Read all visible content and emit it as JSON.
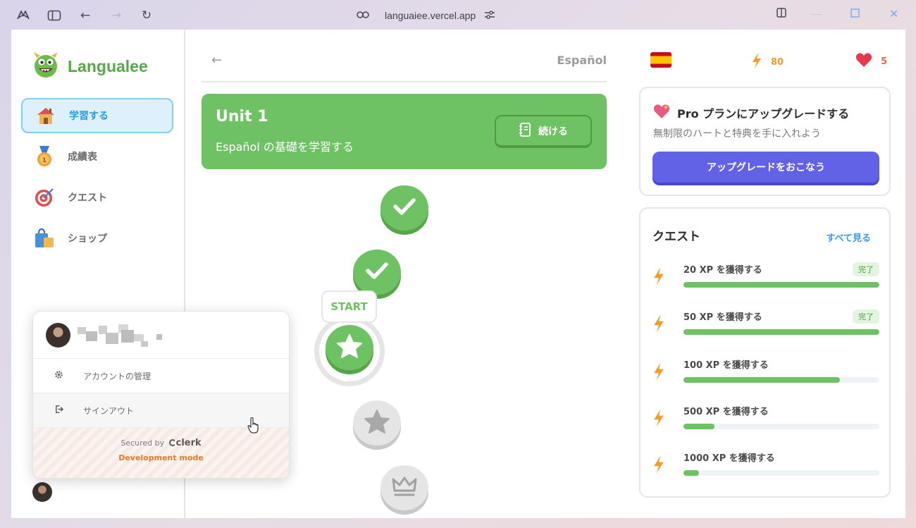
{
  "browser": {
    "url": "languaiee.vercel.app"
  },
  "sidebar": {
    "logo_text": "Langualee",
    "items": [
      {
        "label": "学習する",
        "icon": "house-icon",
        "active": true
      },
      {
        "label": "成績表",
        "icon": "medal-icon",
        "active": false
      },
      {
        "label": "クエスト",
        "icon": "target-icon",
        "active": false
      },
      {
        "label": "ショップ",
        "icon": "shopping-bag-icon",
        "active": false
      }
    ]
  },
  "user_popup": {
    "manage_account": "アカウントの管理",
    "sign_out": "サインアウト",
    "secured_by": "Secured by",
    "clerk_brand": "clerk",
    "dev_mode": "Development mode"
  },
  "header": {
    "language": "Español"
  },
  "unit": {
    "title": "Unit 1",
    "description": "Español の基礎を学習する",
    "continue_label": "続ける"
  },
  "lessons": {
    "start_label": "START"
  },
  "stats": {
    "points": "80",
    "hearts": "5"
  },
  "pro": {
    "title": "Pro プランにアップグレードする",
    "description": "無制限のハートと特典を手に入れよう",
    "button": "アップグレードをおこなう"
  },
  "quests": {
    "title": "クエスト",
    "see_all": "すべて見る",
    "items": [
      {
        "label": "20 XP を獲得する",
        "badge": "完了",
        "progress": 1.0
      },
      {
        "label": "50 XP を獲得する",
        "badge": "完了",
        "progress": 1.0
      },
      {
        "label": "100 XP を獲得する",
        "badge": "",
        "progress": 0.8
      },
      {
        "label": "500 XP を獲得する",
        "badge": "",
        "progress": 0.16
      },
      {
        "label": "1000 XP を獲得する",
        "badge": "",
        "progress": 0.08
      }
    ]
  },
  "colors": {
    "accent_green": "#6fc263",
    "accent_blue": "#2d9ae0",
    "upgrade_purple": "#6262e6",
    "points_orange": "#f39c2b",
    "hearts_red": "#e53950"
  }
}
